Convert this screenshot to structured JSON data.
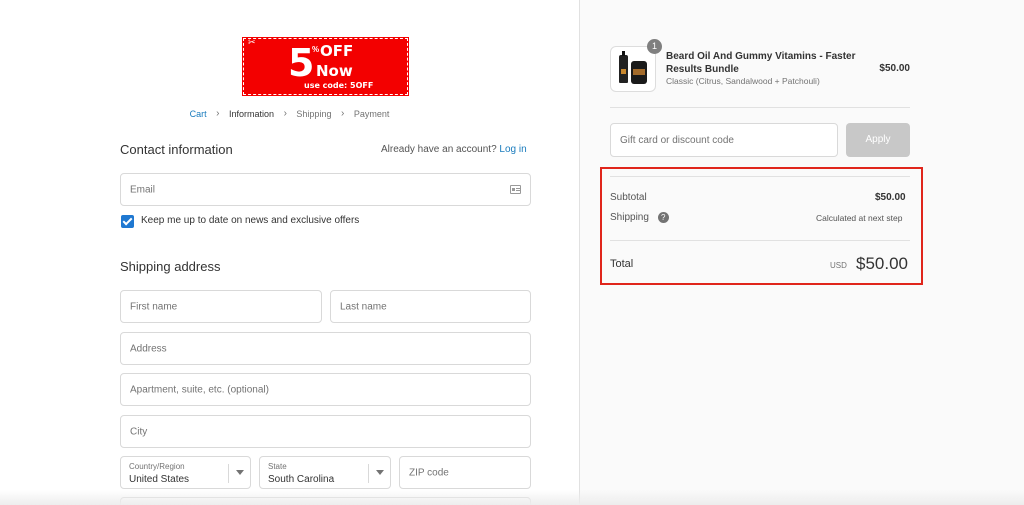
{
  "banner": {
    "big": "5",
    "percent": "%",
    "off": "OFF",
    "now": "Now",
    "code": "use code: 5OFF"
  },
  "breadcrumb": {
    "cart": "Cart",
    "information": "Information",
    "shipping": "Shipping",
    "payment": "Payment",
    "separator": "›"
  },
  "contact": {
    "title": "Contact information",
    "account_prompt": "Already have an account?",
    "login_link": "Log in",
    "email_placeholder": "Email",
    "newsletter_label": "Keep me up to date on news and exclusive offers"
  },
  "shipping": {
    "title": "Shipping address",
    "first_name_placeholder": "First name",
    "last_name_placeholder": "Last name",
    "address_placeholder": "Address",
    "apartment_placeholder": "Apartment, suite, etc. (optional)",
    "city_placeholder": "City",
    "country_label": "Country/Region",
    "country_value": "United States",
    "state_label": "State",
    "state_value": "South Carolina",
    "zip_placeholder": "ZIP code"
  },
  "order": {
    "quantity": "1",
    "product_name": "Beard Oil And Gummy Vitamins - Faster Results Bundle",
    "variant": "Classic (Citrus, Sandalwood + Patchouli)",
    "price": "$50.00",
    "discount_placeholder": "Gift card or discount code",
    "apply_label": "Apply",
    "subtotal_label": "Subtotal",
    "subtotal_value": "$50.00",
    "shipping_label": "Shipping",
    "shipping_help": "?",
    "shipping_value": "Calculated at next step",
    "total_label": "Total",
    "currency": "USD",
    "total_value": "$50.00"
  },
  "colors": {
    "link": "#197bbd",
    "checkbox": "#1f78d1",
    "highlight": "#e0251b",
    "banner": "#f30000"
  }
}
